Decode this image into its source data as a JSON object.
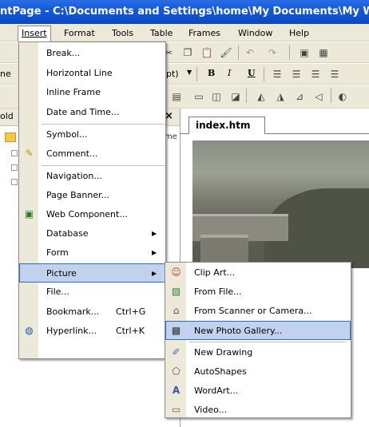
{
  "window": {
    "title": "ntPage - C:\\Documents and Settings\\home\\My Documents\\My W"
  },
  "menubar": {
    "items": [
      "Insert",
      "Format",
      "Tools",
      "Table",
      "Frames",
      "Window",
      "Help"
    ]
  },
  "toolbar2": {
    "style_text": "ne",
    "size_text": "pt)",
    "bold": "B",
    "italic": "I",
    "underline": "U"
  },
  "left_pane": {
    "header_text": "old",
    "close_glyph": "×",
    "fragment": "me"
  },
  "document": {
    "tab_label": "index.htm"
  },
  "insert_menu": {
    "items": [
      {
        "label": "Break...",
        "icon": ""
      },
      {
        "label": "Horizontal Line",
        "icon": ""
      },
      {
        "label": "Inline Frame",
        "icon": ""
      },
      {
        "label": "Date and Time...",
        "icon": ""
      },
      {
        "label": "Symbol...",
        "icon": ""
      },
      {
        "label": "Comment...",
        "icon": "comment-icon"
      },
      {
        "label": "Navigation...",
        "icon": ""
      },
      {
        "label": "Page Banner...",
        "icon": ""
      },
      {
        "label": "Web Component...",
        "icon": "web-component-icon"
      },
      {
        "label": "Database",
        "icon": ""
      },
      {
        "label": "Form",
        "icon": ""
      },
      {
        "label": "Picture",
        "icon": ""
      },
      {
        "label": "File...",
        "icon": ""
      },
      {
        "label": "Bookmark...",
        "shortcut": "Ctrl+G",
        "icon": ""
      },
      {
        "label": "Hyperlink...",
        "shortcut": "Ctrl+K",
        "icon": "hyperlink-icon"
      }
    ]
  },
  "picture_menu": {
    "items": [
      {
        "label": "Clip Art...",
        "icon": "clip-art-icon"
      },
      {
        "label": "From File...",
        "icon": "from-file-icon"
      },
      {
        "label": "From Scanner or Camera...",
        "icon": "scanner-icon"
      },
      {
        "label": "New Photo Gallery...",
        "icon": "photo-gallery-icon"
      },
      {
        "label": "New Drawing",
        "icon": "drawing-icon"
      },
      {
        "label": "AutoShapes",
        "icon": "autoshapes-icon"
      },
      {
        "label": "WordArt...",
        "icon": "wordart-icon"
      },
      {
        "label": "Video...",
        "icon": "video-icon"
      }
    ]
  },
  "colors": {
    "highlight": "#c1d2ee",
    "highlight_border": "#316ac5",
    "titlebar": "#1459d8"
  }
}
